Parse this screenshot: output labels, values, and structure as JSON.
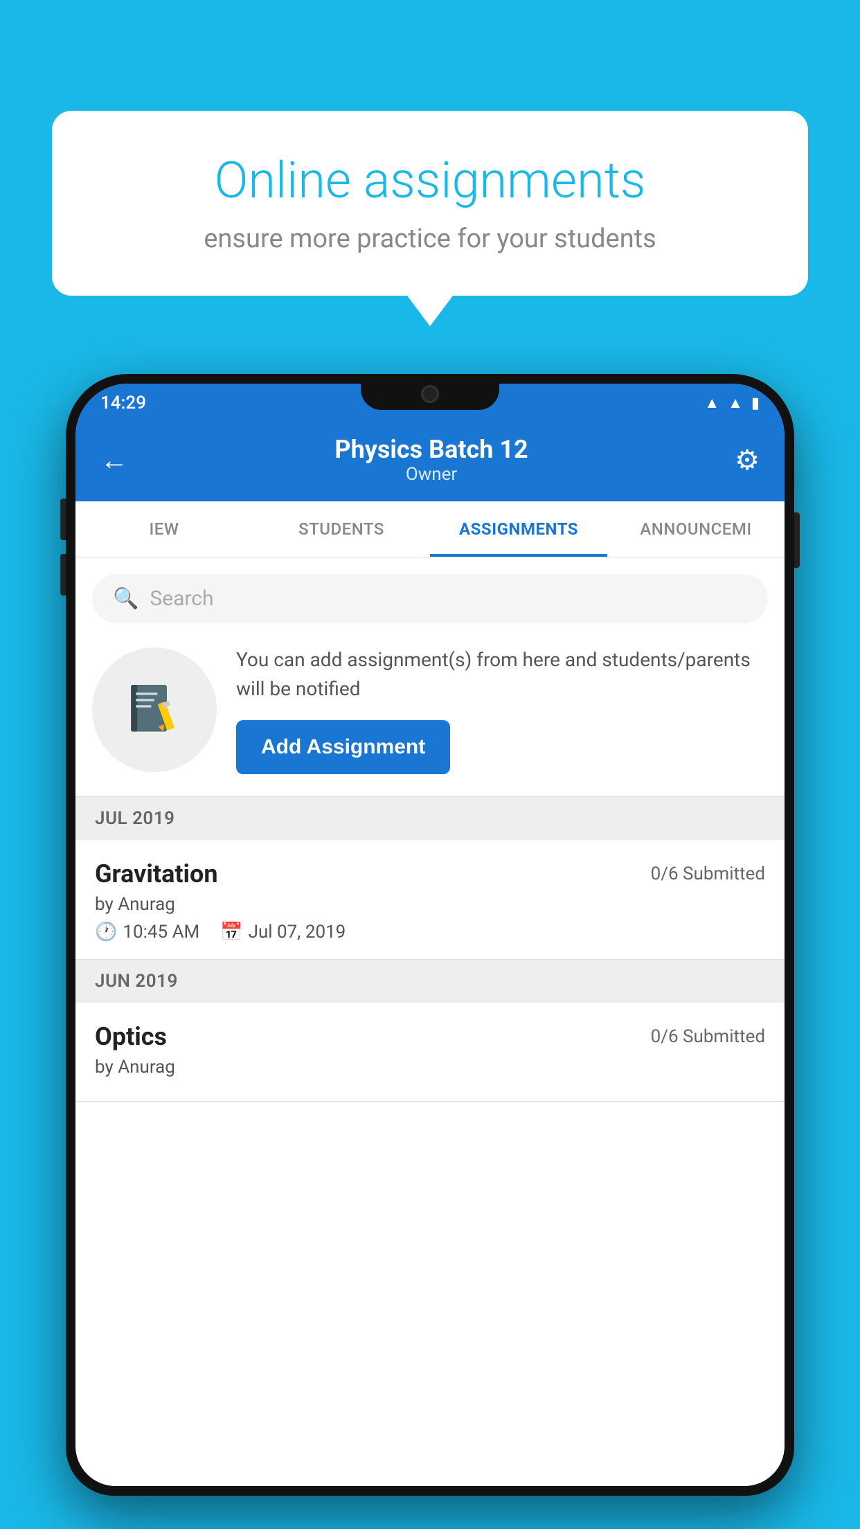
{
  "background_color": "#1ab8e8",
  "speech_bubble": {
    "title": "Online assignments",
    "subtitle": "ensure more practice for your students"
  },
  "phone": {
    "status_bar": {
      "time": "14:29",
      "icons": [
        "wifi",
        "signal",
        "battery"
      ]
    },
    "header": {
      "title": "Physics Batch 12",
      "subtitle": "Owner",
      "back_label": "←",
      "settings_label": "⚙"
    },
    "tabs": [
      {
        "label": "IEW",
        "active": false
      },
      {
        "label": "STUDENTS",
        "active": false
      },
      {
        "label": "ASSIGNMENTS",
        "active": true
      },
      {
        "label": "ANNOUNCEMENTS",
        "active": false
      }
    ],
    "search": {
      "placeholder": "Search"
    },
    "promo": {
      "text": "You can add assignment(s) from here and students/parents will be notified",
      "button_label": "Add Assignment"
    },
    "sections": [
      {
        "month": "JUL 2019",
        "assignments": [
          {
            "title": "Gravitation",
            "submitted": "0/6 Submitted",
            "author": "by Anurag",
            "time": "10:45 AM",
            "date": "Jul 07, 2019"
          }
        ]
      },
      {
        "month": "JUN 2019",
        "assignments": [
          {
            "title": "Optics",
            "submitted": "0/6 Submitted",
            "author": "by Anurag",
            "time": "",
            "date": ""
          }
        ]
      }
    ]
  }
}
